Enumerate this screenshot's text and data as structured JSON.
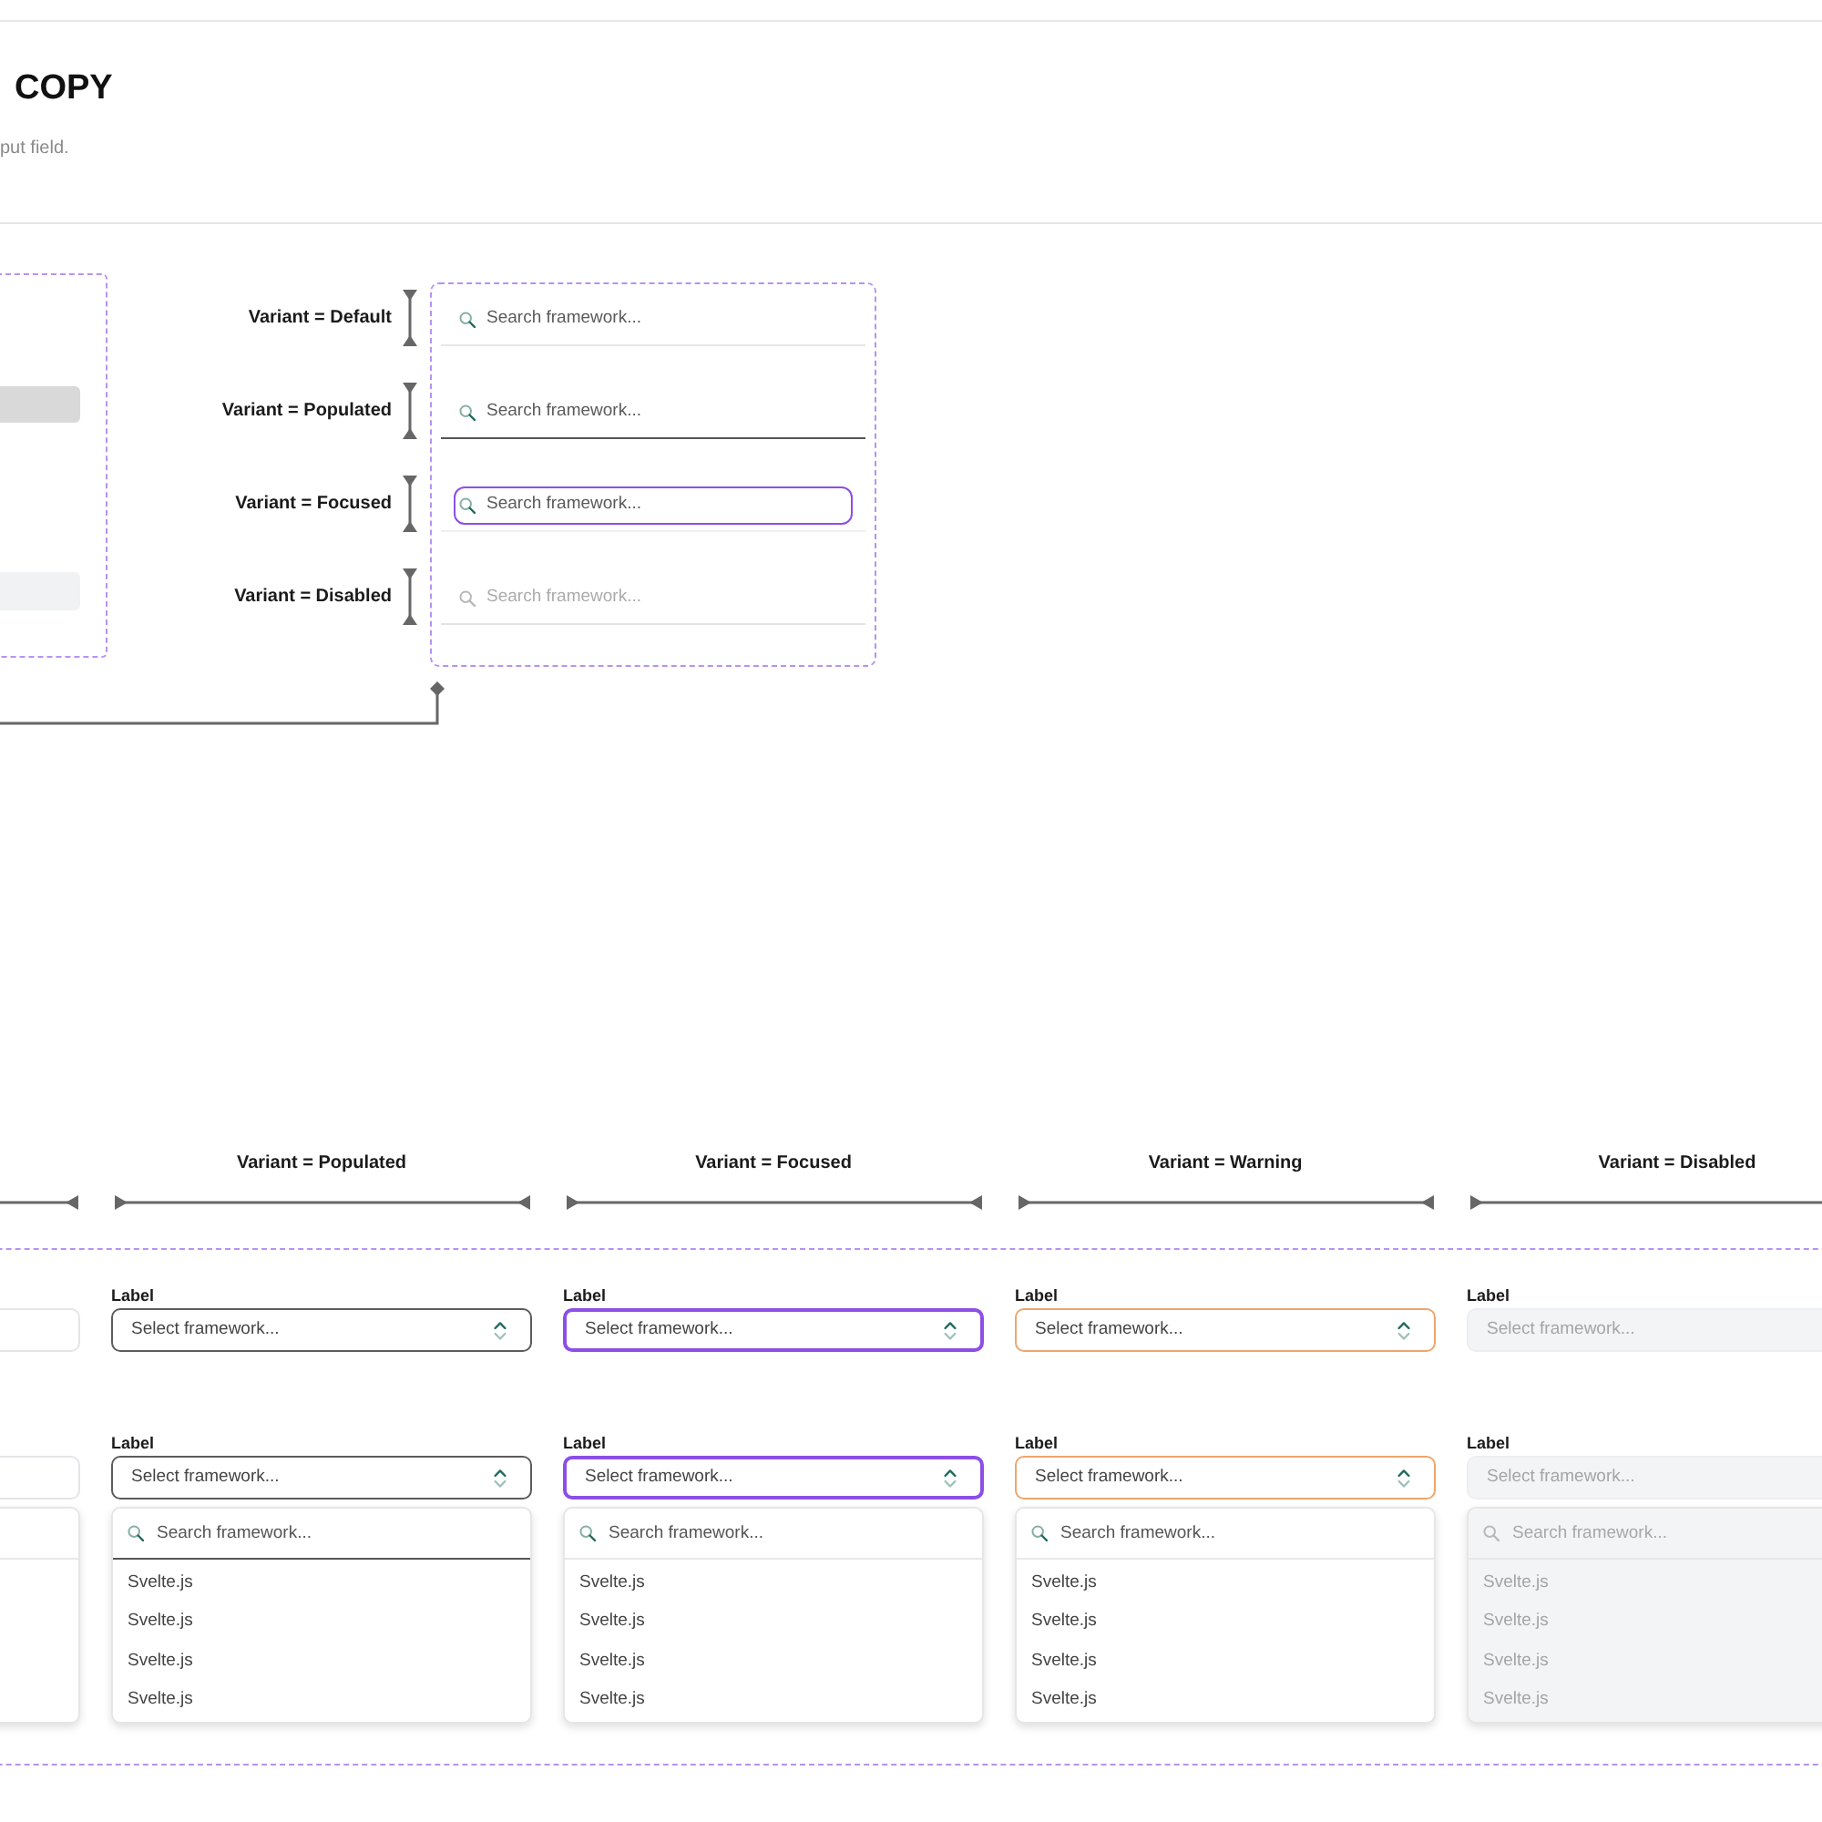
{
  "header": {
    "title": "COPY",
    "description": "put field."
  },
  "search_variants": {
    "rows": [
      {
        "label": "Variant = Default",
        "kind": "default",
        "placeholder": "Search framework..."
      },
      {
        "label": "Variant = Populated",
        "kind": "populated",
        "placeholder": "Search framework..."
      },
      {
        "label": "Variant = Focused",
        "kind": "focused",
        "placeholder": "Search framework..."
      },
      {
        "label": "Variant = Disabled",
        "kind": "disabled",
        "placeholder": "Search framework..."
      }
    ]
  },
  "select_variants": {
    "columns": [
      {
        "kind": "default"
      },
      {
        "heading": "Variant = Populated",
        "kind": "populated",
        "closed": {
          "label": "Label",
          "placeholder": "Select framework..."
        },
        "open": {
          "label": "Label",
          "placeholder": "Select framework...",
          "search": {
            "placeholder": "Search framework..."
          },
          "options": [
            "Svelte.js",
            "Svelte.js",
            "Svelte.js",
            "Svelte.js"
          ]
        }
      },
      {
        "heading": "Variant = Focused",
        "kind": "focused",
        "closed": {
          "label": "Label",
          "placeholder": "Select framework..."
        },
        "open": {
          "label": "Label",
          "placeholder": "Select framework...",
          "search": {
            "placeholder": "Search framework..."
          },
          "options": [
            "Svelte.js",
            "Svelte.js",
            "Svelte.js",
            "Svelte.js"
          ]
        }
      },
      {
        "heading": "Variant = Warning",
        "kind": "warning",
        "closed": {
          "label": "Label",
          "placeholder": "Select framework..."
        },
        "open": {
          "label": "Label",
          "placeholder": "Select framework...",
          "search": {
            "placeholder": "Search framework..."
          },
          "options": [
            "Svelte.js",
            "Svelte.js",
            "Svelte.js",
            "Svelte.js"
          ]
        }
      },
      {
        "heading": "Variant = Disabled",
        "kind": "disabled",
        "closed": {
          "label": "Label",
          "placeholder": "Select framework..."
        },
        "open": {
          "label": "Label",
          "placeholder": "Select framework...",
          "search": {
            "placeholder": "Search framework..."
          },
          "options": [
            "Svelte.js",
            "Svelte.js",
            "Svelte.js",
            "Svelte.js"
          ]
        }
      }
    ]
  }
}
